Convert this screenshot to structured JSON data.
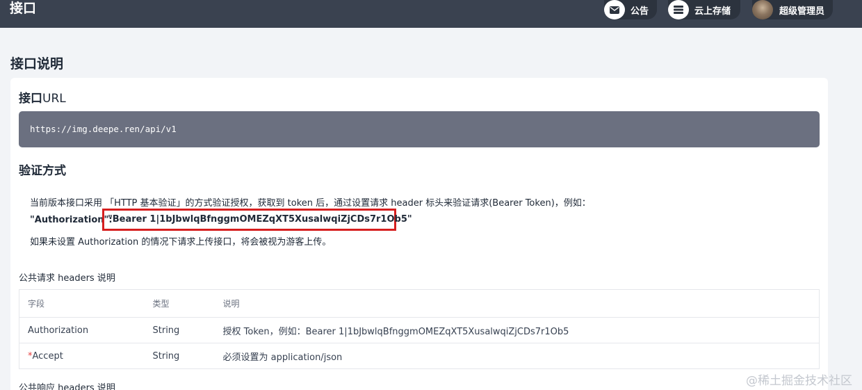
{
  "topbar": {
    "title": "接口",
    "notice_label": "公告",
    "cloud_label": "云上存储",
    "user_label": "超级管理员",
    "notice_icon": "envelope-icon",
    "cloud_icon": "server-icon"
  },
  "page": {
    "title": "接口说明"
  },
  "url_section": {
    "heading_bold": "接口",
    "heading_rest": "URL",
    "url": "https://img.deepe.ren/api/v1"
  },
  "auth_section": {
    "heading": "验证方式",
    "description": "当前版本接口采用 「HTTP 基本验证」的方式验证授权，获取到 token 后，通过设置请求 header 标头来验证请求(Bearer Token)，例如：",
    "example_key": "\"Authorization\":",
    "example_value": "\"Bearer 1|1bJbwlqBfnggmOMEZqXT5XusalwqiZjCDs7r1Ob5\"",
    "note": "如果未设置 Authorization 的情况下请求上传接口，将会被视为游客上传。"
  },
  "request_headers": {
    "title": "公共请求 headers 说明",
    "columns": [
      "字段",
      "类型",
      "说明"
    ],
    "rows": [
      {
        "required": "",
        "field": "Authorization",
        "type": "String",
        "desc": "授权 Token，例如：Bearer 1|1bJbwlqBfnggmOMEZqXT5XusalwqiZjCDs7r1Ob5"
      },
      {
        "required": "*",
        "field": "Accept",
        "type": "String",
        "desc": "必须设置为 application/json"
      }
    ]
  },
  "response_headers": {
    "title": "公共响应 headers 说明"
  },
  "watermark": "@稀土掘金技术社区",
  "colors": {
    "topbar": "#3a4250",
    "code_bg": "#6b7080",
    "highlight_border": "#d61f1f",
    "required": "#e53e3e"
  }
}
